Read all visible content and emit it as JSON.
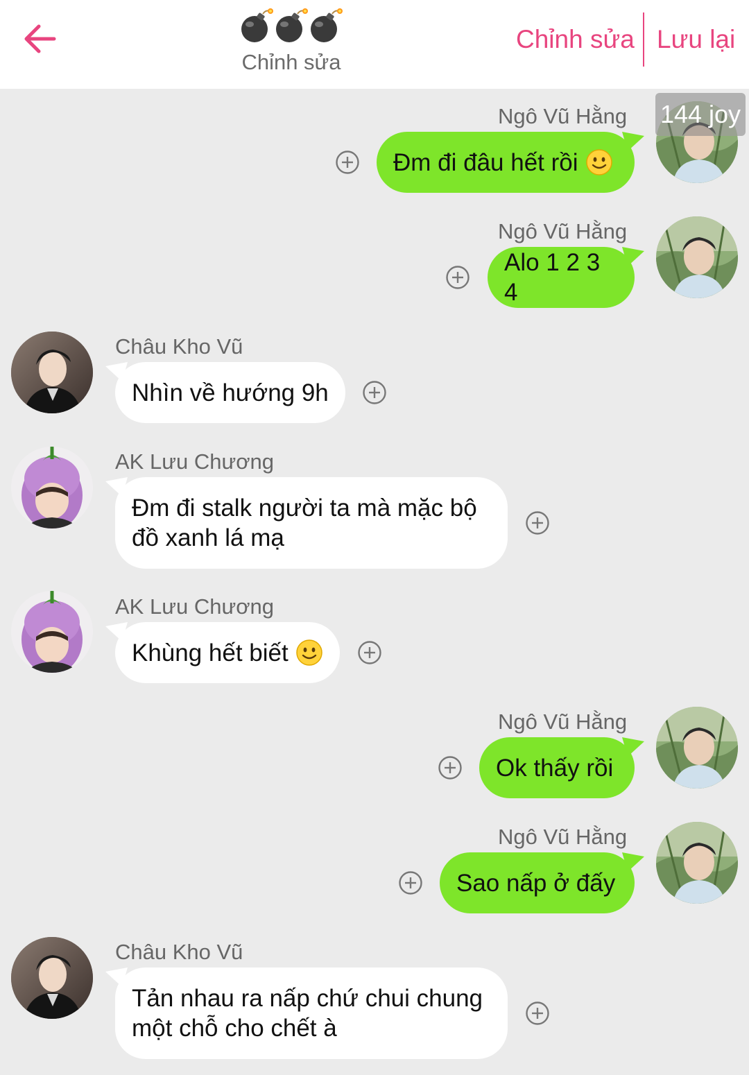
{
  "header": {
    "subtitle": "Chỉnh sửa",
    "edit_label": "Chỉnh sửa",
    "save_label": "Lưu lại",
    "accent_color": "#e8457f",
    "title_icons": [
      "bomb-icon",
      "bomb-icon",
      "bomb-icon"
    ]
  },
  "watermark": "144 joy",
  "messages": [
    {
      "side": "right",
      "sender": "Ngô Vũ Hằng",
      "text": "Đm đi đâu hết rồi",
      "emoji": "slight-smile-icon",
      "avatar": "avatar-ngo-vu-hang"
    },
    {
      "side": "right",
      "sender": "Ngô Vũ Hằng",
      "text": "Alo 1 2 3 4",
      "avatar": "avatar-ngo-vu-hang"
    },
    {
      "side": "left",
      "sender": "Châu Kho Vũ",
      "text": "Nhìn về hướng 9h",
      "avatar": "avatar-chau-kho-vu"
    },
    {
      "side": "left",
      "sender": "AK Lưu Chương",
      "text_line1": "Đm đi stalk người ta mà mặc bộ",
      "text_line2": "đồ xanh lá mạ",
      "avatar": "avatar-ak-luu-chuong"
    },
    {
      "side": "left",
      "sender": "AK Lưu Chương",
      "text": "Khùng hết biết",
      "emoji": "slight-smile-icon",
      "avatar": "avatar-ak-luu-chuong"
    },
    {
      "side": "right",
      "sender": "Ngô Vũ Hằng",
      "text": "Ok thấy rồi",
      "avatar": "avatar-ngo-vu-hang"
    },
    {
      "side": "right",
      "sender": "Ngô Vũ Hằng",
      "text": "Sao nấp ở đấy",
      "avatar": "avatar-ngo-vu-hang"
    },
    {
      "side": "left",
      "sender": "Châu Kho Vũ",
      "text_line1": "Tản nhau ra nấp chứ chui chung",
      "text_line2": "một chỗ cho chết à",
      "avatar": "avatar-chau-kho-vu"
    }
  ],
  "colors": {
    "sent_bubble": "#7ee52a",
    "received_bubble": "#ffffff",
    "background": "#ebebeb"
  }
}
